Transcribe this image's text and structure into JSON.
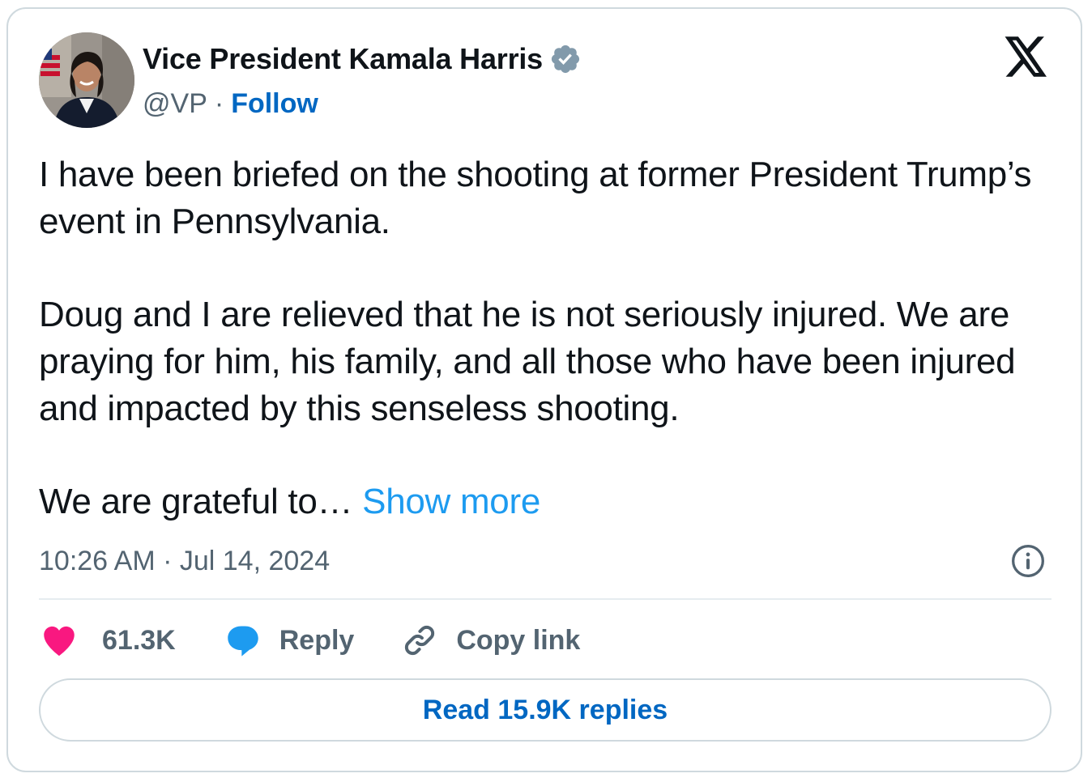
{
  "author": {
    "display_name": "Vice President Kamala Harris",
    "handle": "@VP",
    "separator": "·",
    "follow_label": "Follow",
    "verified_color": "#829aab"
  },
  "tweet": {
    "paragraphs": [
      "I have been briefed on the shooting at former President Trump’s event in Pennsylvania.",
      "Doug and I are relieved that he is not seriously injured. We are praying for him, his family, and all those who have been injured and impacted by this senseless shooting."
    ],
    "truncated_text": "We are grateful to… ",
    "show_more_label": "Show more"
  },
  "meta": {
    "timestamp": "10:26 AM · Jul 14, 2024"
  },
  "actions": {
    "like_count": "61.3K",
    "reply_label": "Reply",
    "copy_link_label": "Copy link"
  },
  "read_replies_label": "Read 15.9K replies",
  "colors": {
    "like": "#f91880",
    "reply": "#1d9bf0",
    "link": "#0067c2",
    "show_more": "#1d9bf0",
    "secondary_text": "#536471",
    "border": "#cfd9de"
  },
  "icons": [
    "verified-badge-icon",
    "x-logo-icon",
    "info-icon",
    "heart-icon",
    "reply-bubble-icon",
    "link-icon"
  ]
}
